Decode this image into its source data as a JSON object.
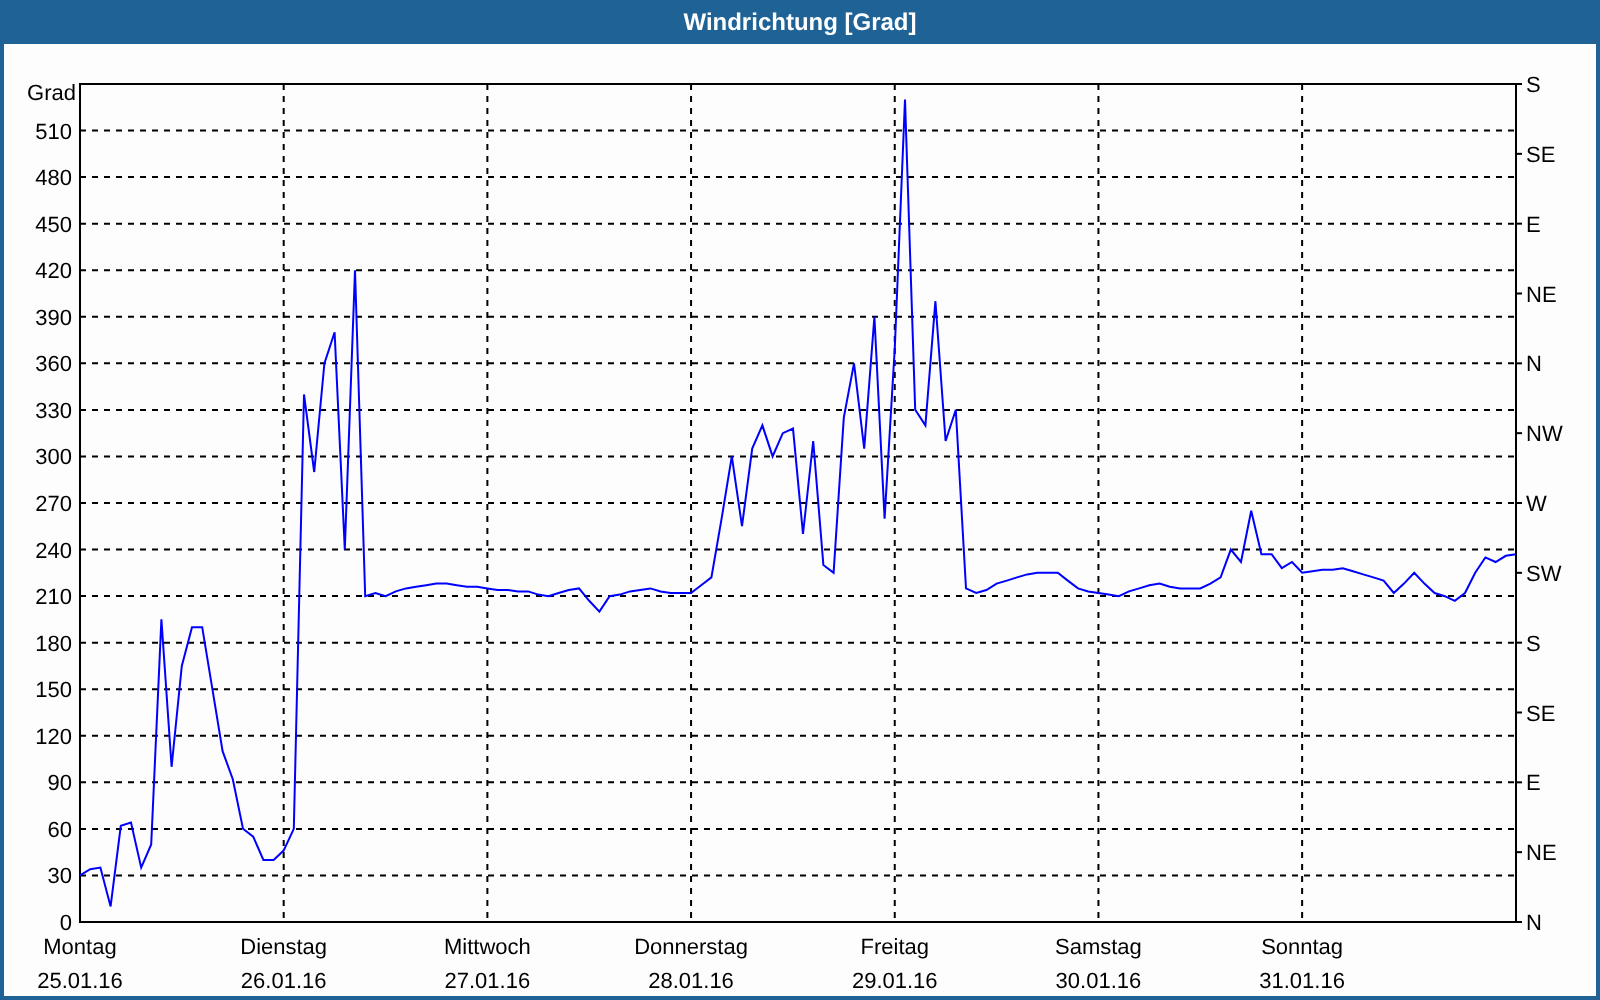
{
  "window": {
    "title": "Windrichtung [Grad]"
  },
  "chart": {
    "date_labels": [
      "25.01.16",
      "26.01.16",
      "27.01.16",
      "28.01.16",
      "29.01.16",
      "30.01.16",
      "31.01.16"
    ],
    "compass_labels": [
      "S",
      "SE",
      "E",
      "NE",
      "N",
      "NW",
      "W",
      "SW",
      "S",
      "SE",
      "E",
      "NE",
      "N"
    ],
    "chart_data": {
      "type": "line",
      "grid": true,
      "ylabel": "Grad",
      "ylim": [
        0,
        540
      ],
      "yticks": [
        0,
        30,
        60,
        90,
        120,
        150,
        180,
        210,
        240,
        270,
        300,
        330,
        360,
        390,
        420,
        450,
        480,
        510
      ],
      "categories": [
        "Montag",
        null,
        null,
        null,
        null,
        null,
        null,
        null,
        null,
        null,
        null,
        null,
        null,
        null,
        null,
        null,
        null,
        null,
        null,
        null,
        "Dienstag",
        null,
        null,
        null,
        null,
        null,
        null,
        null,
        null,
        null,
        null,
        null,
        null,
        null,
        null,
        null,
        null,
        null,
        null,
        null,
        "Mittwoch",
        null,
        null,
        null,
        null,
        null,
        null,
        null,
        null,
        null,
        null,
        null,
        null,
        null,
        null,
        null,
        null,
        null,
        null,
        null,
        "Donnerstag",
        null,
        null,
        null,
        null,
        null,
        null,
        null,
        null,
        null,
        null,
        null,
        null,
        null,
        null,
        null,
        null,
        null,
        null,
        null,
        "Freitag",
        null,
        null,
        null,
        null,
        null,
        null,
        null,
        null,
        null,
        null,
        null,
        null,
        null,
        null,
        null,
        null,
        null,
        null,
        null,
        "Samstag",
        null,
        null,
        null,
        null,
        null,
        null,
        null,
        null,
        null,
        null,
        null,
        null,
        null,
        null,
        null,
        null,
        null,
        null,
        null,
        "Sonntag",
        null,
        null,
        null,
        null,
        null,
        null,
        null,
        null,
        null,
        null,
        null,
        null,
        null,
        null,
        null,
        null,
        null,
        null,
        null,
        null,
        null
      ],
      "series": [
        {
          "color": "#0000ff",
          "values": [
            30,
            34,
            35,
            10,
            62,
            64,
            35,
            50,
            195,
            100,
            165,
            190,
            190,
            150,
            110,
            92,
            60,
            55,
            40,
            40,
            46,
            60,
            340,
            290,
            360,
            380,
            240,
            420,
            210,
            212,
            210,
            213,
            215,
            216,
            217,
            218,
            218,
            217,
            216,
            216,
            215,
            214,
            214,
            213,
            213,
            211,
            210,
            212,
            214,
            215,
            207,
            200,
            210,
            211,
            213,
            214,
            215,
            213,
            212,
            212,
            212,
            217,
            222,
            260,
            300,
            255,
            305,
            320,
            300,
            315,
            318,
            250,
            310,
            230,
            225,
            325,
            360,
            305,
            390,
            260,
            370,
            530,
            330,
            320,
            400,
            310,
            330,
            215,
            212,
            214,
            218,
            220,
            222,
            224,
            225,
            225,
            225,
            220,
            215,
            213,
            212,
            211,
            210,
            213,
            215,
            217,
            218,
            216,
            215,
            215,
            215,
            218,
            222,
            240,
            232,
            265,
            237,
            237,
            228,
            232,
            225,
            226,
            227,
            227,
            228,
            226,
            224,
            222,
            220,
            212,
            218,
            225,
            218,
            212,
            210,
            207,
            212,
            225,
            235,
            232,
            236,
            237
          ]
        }
      ]
    }
  }
}
